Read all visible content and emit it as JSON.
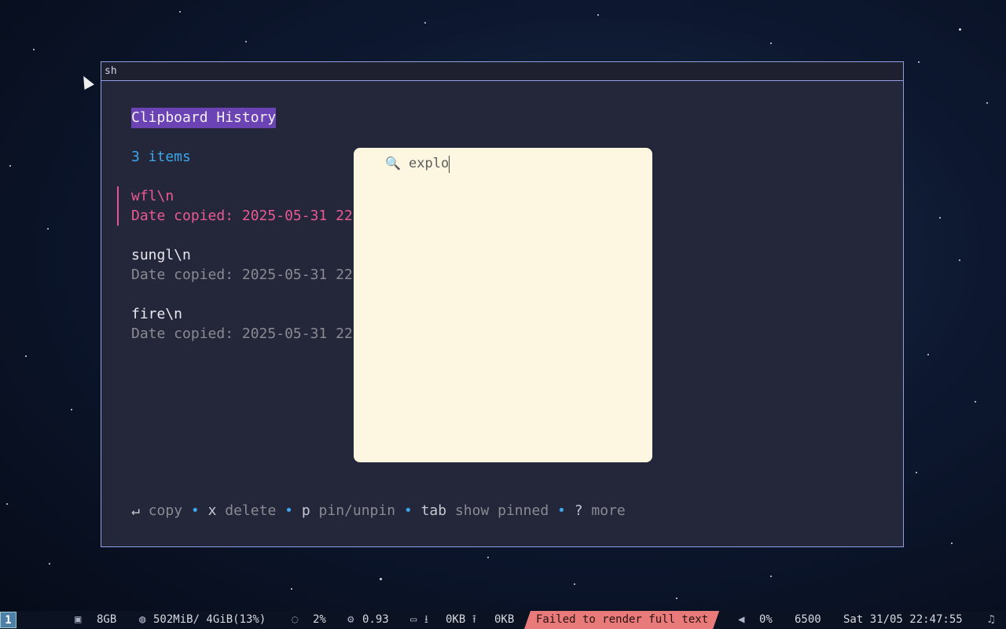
{
  "window": {
    "title": "sh"
  },
  "clipboard": {
    "heading": "Clipboard History",
    "count_label": "3 items",
    "entries": [
      {
        "text": "wfl\\n",
        "date": "Date copied: 2025-05-31 22",
        "selected": true
      },
      {
        "text": "sungl\\n",
        "date": "Date copied: 2025-05-31 22",
        "selected": false
      },
      {
        "text": "fire\\n",
        "date": "Date copied: 2025-05-31 22",
        "selected": false
      }
    ],
    "help": {
      "copy_key": "↵",
      "copy_label": "copy",
      "delete_key": "x",
      "delete_label": "delete",
      "pin_key": "p",
      "pin_label": "pin/unpin",
      "tab_key": "tab",
      "tab_label": "show pinned",
      "more_key": "?",
      "more_label": "more",
      "separator": "•"
    }
  },
  "search": {
    "icon": "search-icon",
    "value": "explo"
  },
  "statusbar": {
    "workspace": "1",
    "disk": "8GB",
    "memory": "502MiB/ 4GiB(13%)",
    "cpu": "2%",
    "load": "0.93",
    "net_down": "0KB",
    "net_up": "0KB",
    "error": "Failed to render full text",
    "volume": "0%",
    "color_temp": "6500",
    "datetime": "Sat 31/05 22:47:55"
  },
  "colors": {
    "accent": "#6b43b5",
    "selected": "#ea5a92",
    "info": "#3da5ea",
    "error_bg": "#e87a7a"
  }
}
